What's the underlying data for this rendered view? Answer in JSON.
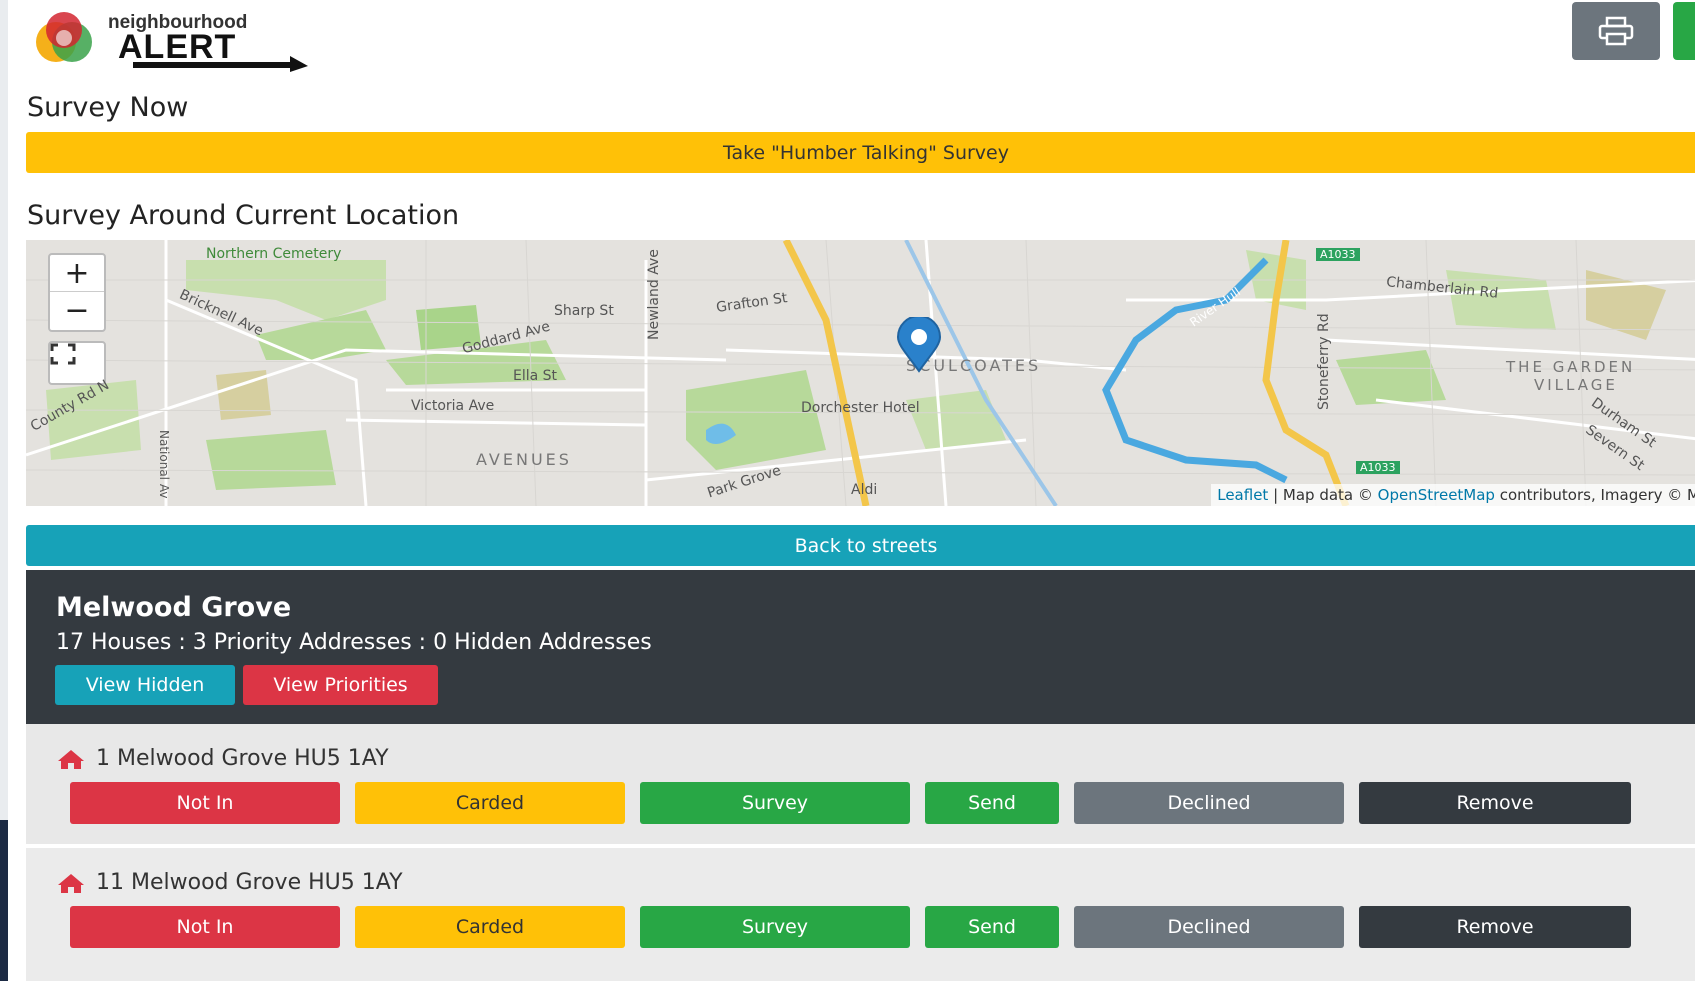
{
  "header": {
    "logo_line1": "neighbourhood",
    "logo_line2": "ALERT"
  },
  "survey_now": {
    "title": "Survey Now",
    "button_label": "Take \"Humber Talking\" Survey"
  },
  "location": {
    "title": "Survey Around Current Location",
    "zoom_in": "+",
    "zoom_out": "−",
    "map_labels": {
      "northern_cemetery": "Northern Cemetery",
      "bricknell_ave": "Bricknell Ave",
      "sharp_st": "Sharp St",
      "goddard_ave": "Goddard Ave",
      "ella_st": "Ella St",
      "victoria_ave": "Victoria Ave",
      "county_rd_n": "County Rd N",
      "avenues": "AVENUES",
      "newland_ave": "Newland Ave",
      "grafton_st": "Grafton St",
      "sculcoates": "SCULCOATES",
      "dorchester_hotel": "Dorchester Hotel",
      "park_grove": "Park Grove",
      "aldi": "Aldi",
      "river_hull": "River Hull",
      "a1033_top": "A1033",
      "a1033_bottom": "A1033",
      "stoneferry_rd": "Stoneferry Rd",
      "chamberlain_rd": "Chamberlain Rd",
      "garden_village_1": "THE GARDEN",
      "garden_village_2": "VILLAGE",
      "durham_st": "Durham St",
      "severn_st": "Severn St",
      "national_av": "National Av"
    },
    "attribution": {
      "leaflet": "Leaflet",
      "sep": " | Map data © ",
      "osm": "OpenStreetMap",
      "rest": " contributors, Imagery © M"
    }
  },
  "back_button": "Back to streets",
  "street": {
    "name": "Melwood Grove",
    "stats": "17 Houses : 3 Priority Addresses : 0 Hidden Addresses",
    "view_hidden": "View Hidden",
    "view_priorities": "View Priorities"
  },
  "addresses": [
    {
      "label": "1 Melwood Grove HU5 1AY"
    },
    {
      "label": "11 Melwood Grove HU5 1AY"
    }
  ],
  "actions": {
    "not_in": "Not In",
    "carded": "Carded",
    "survey": "Survey",
    "send": "Send",
    "declined": "Declined",
    "remove": "Remove"
  },
  "colors": {
    "yellow": "#ffc107",
    "teal": "#17a2b8",
    "red": "#dc3545",
    "green": "#28a745",
    "gray": "#6c757d",
    "dark": "#343a40",
    "marker": "#2a81cb"
  },
  "icons": {
    "print": "print-icon",
    "home": "home-icon",
    "marker": "map-marker-icon",
    "fullscreen": "fullscreen-icon"
  }
}
